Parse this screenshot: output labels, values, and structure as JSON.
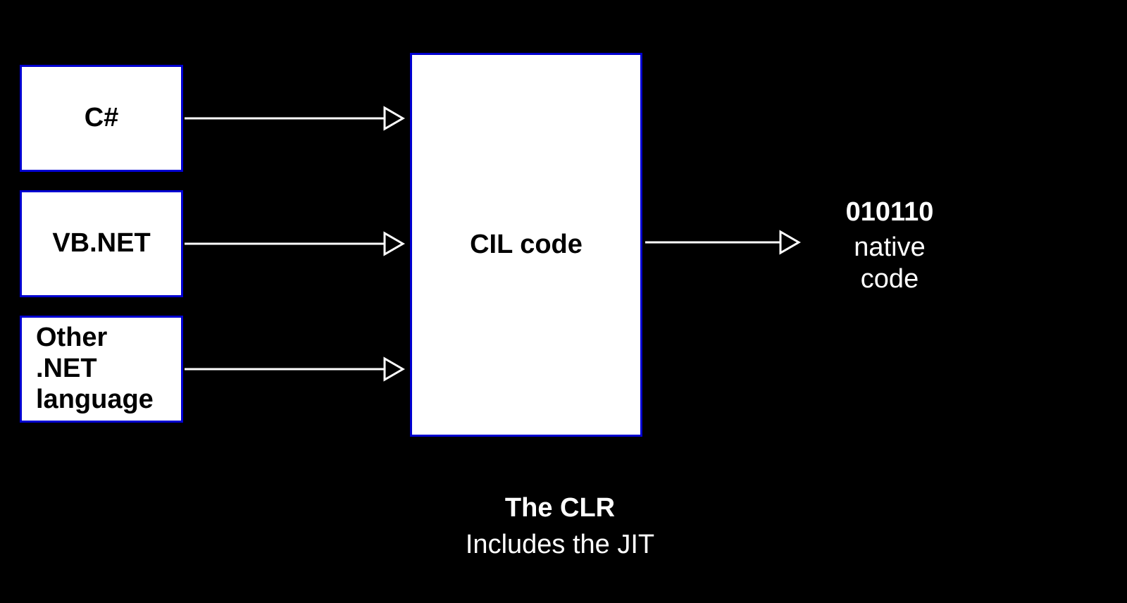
{
  "diagram": {
    "sources": {
      "csharp": "C#",
      "vbnet": "VB.NET",
      "other": "Other .NET language"
    },
    "cil": "CIL code",
    "output": {
      "title": "010110",
      "sub1": "native",
      "sub2": "code"
    },
    "caption": {
      "title": "The CLR",
      "sub": "Includes the JIT"
    }
  }
}
